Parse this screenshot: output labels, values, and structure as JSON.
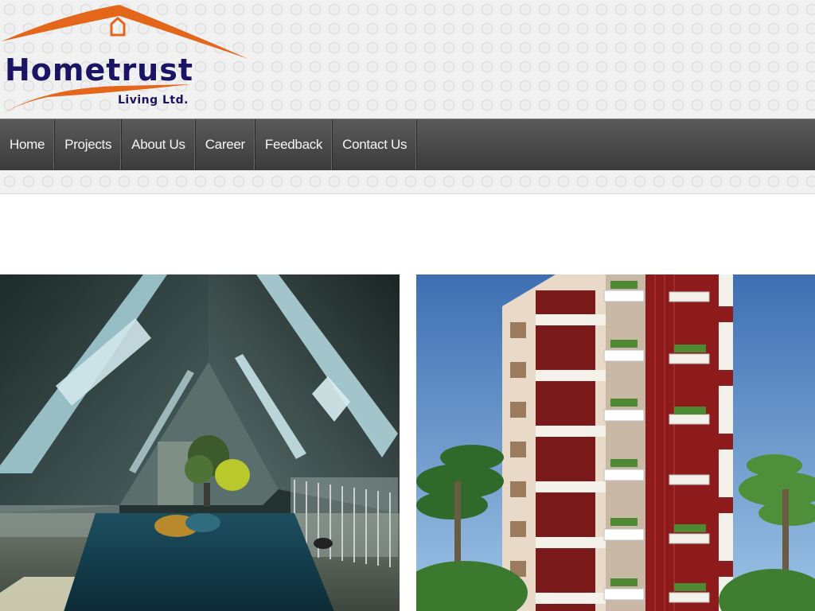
{
  "brand": {
    "name": "Hometrust",
    "tagline": "Living Ltd.",
    "colors": {
      "navy": "#1b1464",
      "orange": "#e4661b"
    }
  },
  "nav": {
    "items": [
      {
        "label": "Home"
      },
      {
        "label": "Projects"
      },
      {
        "label": "About Us"
      },
      {
        "label": "Career"
      },
      {
        "label": "Feedback"
      },
      {
        "label": "Contact Us"
      }
    ]
  },
  "gallery": {
    "images": [
      {
        "subject": "attic-bedroom-interior"
      },
      {
        "subject": "apartment-building-exterior"
      }
    ]
  }
}
